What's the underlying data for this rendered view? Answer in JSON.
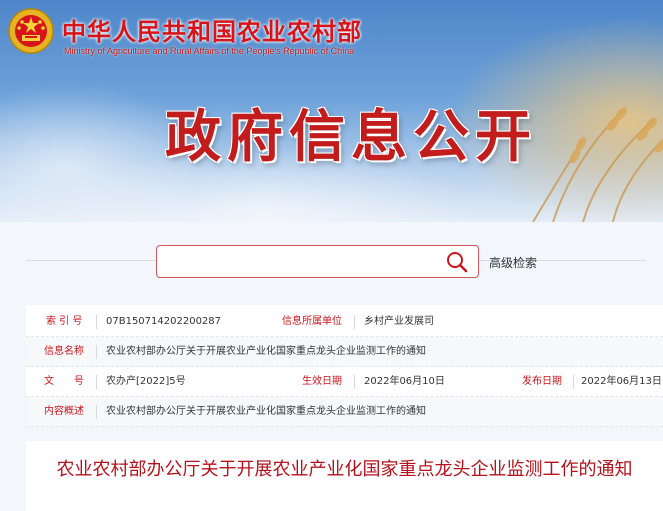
{
  "header": {
    "site_title": "中华人民共和国农业农村部",
    "site_subtitle": "Ministry of Agriculture and Rural Affairs of the People's Republic of China",
    "banner_title": "政府信息公开",
    "emblem_icon": "national-emblem-icon"
  },
  "search": {
    "placeholder": "",
    "value": "",
    "button_icon": "search-icon",
    "advanced_label": "高级检索"
  },
  "info": {
    "index_label": "索 引 号",
    "index_value": "07B150714202200287",
    "unit_label": "信息所属单位",
    "unit_value": "乡村产业发展司",
    "name_label": "信息名称",
    "name_value": "农业农村部办公厅关于开展农业产业化国家重点龙头企业监测工作的通知",
    "docno_label": "文　　号",
    "docno_value": "农办产[2022]5号",
    "gendate_label": "生效日期",
    "gendate_value": "2022年06月10日",
    "pubdate_label": "发布日期",
    "pubdate_value": "2022年06月13日",
    "summary_label": "内容概述",
    "summary_value": "农业农村部办公厅关于开展农业产业化国家重点龙头企业监测工作的通知"
  },
  "article": {
    "title": "农业农村部办公厅关于开展农业产业化国家重点龙头企业监测工作的通知"
  },
  "colors": {
    "brand_red": "#c8161d",
    "banner_blue": "#4d86c9"
  }
}
